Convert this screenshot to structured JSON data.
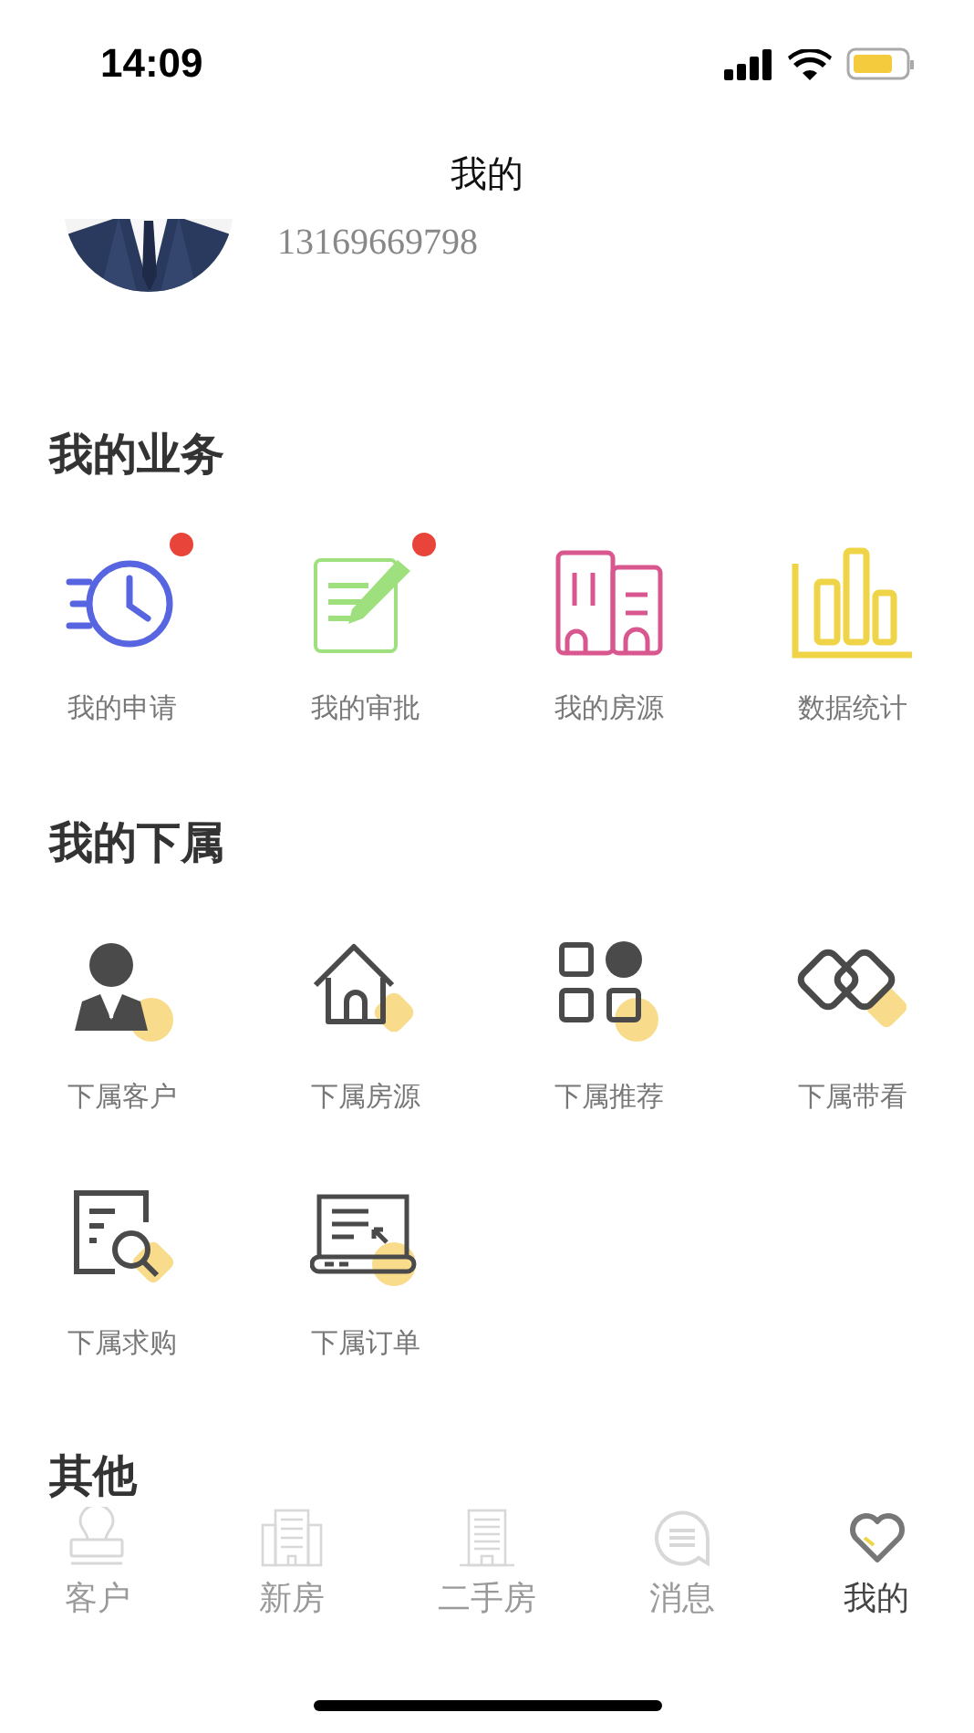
{
  "status_bar": {
    "time": "14:09"
  },
  "title": "我的",
  "profile": {
    "phone": "13169669798"
  },
  "sections": [
    {
      "title": "我的业务",
      "items": [
        {
          "label": "我的申请",
          "kind": "clock",
          "badge": true
        },
        {
          "label": "我的审批",
          "kind": "edit",
          "badge": true
        },
        {
          "label": "我的房源",
          "kind": "buildings",
          "badge": false
        },
        {
          "label": "数据统计",
          "kind": "chart",
          "badge": false
        }
      ]
    },
    {
      "title": "我的下属",
      "items": [
        {
          "label": "下属客户",
          "kind": "person",
          "badge": false
        },
        {
          "label": "下属房源",
          "kind": "house",
          "badge": false
        },
        {
          "label": "下属推荐",
          "kind": "apps",
          "badge": false
        },
        {
          "label": "下属带看",
          "kind": "link",
          "badge": false
        },
        {
          "label": "下属求购",
          "kind": "search",
          "badge": false
        },
        {
          "label": "下属订单",
          "kind": "laptop",
          "badge": false
        }
      ]
    },
    {
      "title": "其他"
    }
  ],
  "tab_bar": [
    {
      "label": "客户",
      "kind": "stamp",
      "selected": false
    },
    {
      "label": "新房",
      "kind": "block",
      "selected": false
    },
    {
      "label": "二手房",
      "kind": "tower",
      "selected": false
    },
    {
      "label": "消息",
      "kind": "chat",
      "selected": false
    },
    {
      "label": "我的",
      "kind": "heart",
      "selected": true
    }
  ]
}
